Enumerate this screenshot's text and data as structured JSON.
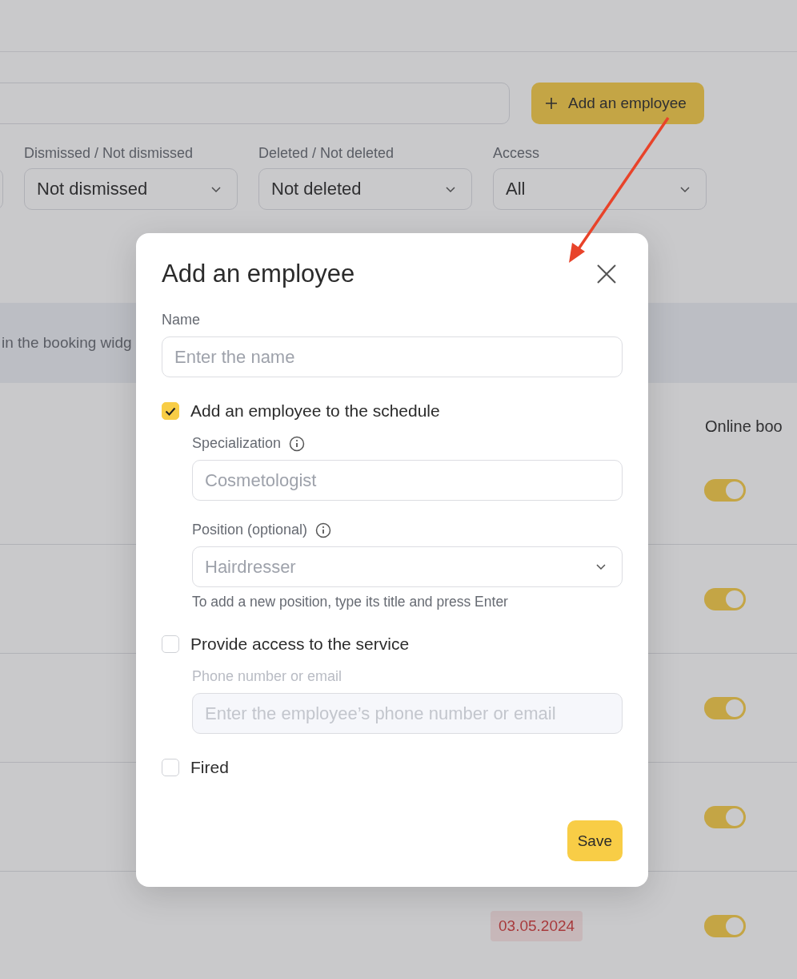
{
  "toolbar": {
    "add_button": "Add an employee"
  },
  "filters": [
    {
      "label": "Dismissed / Not dismissed",
      "value": "Not dismissed"
    },
    {
      "label": "Deleted / Not deleted",
      "value": "Not deleted"
    },
    {
      "label": "Access",
      "value": "All"
    }
  ],
  "banner": {
    "text": "in the booking widg"
  },
  "table": {
    "columns": [
      "Online boo"
    ],
    "rows": [
      {
        "online_booking": true
      },
      {
        "online_booking": true
      },
      {
        "online_booking": true
      },
      {
        "online_booking": true
      },
      {
        "date": "03.05.2024",
        "online_booking": true
      }
    ]
  },
  "modal": {
    "title": "Add an employee",
    "name_field": {
      "label": "Name",
      "placeholder": "Enter the name"
    },
    "schedule": {
      "label": "Add an employee to the schedule",
      "checked": true,
      "specialization": {
        "label": "Specialization",
        "placeholder": "Cosmetologist"
      },
      "position": {
        "label": "Position (optional)",
        "placeholder": "Hairdresser",
        "hint": "To add a new position, type its title and press Enter"
      }
    },
    "access": {
      "label": "Provide access to the service",
      "checked": false,
      "contact": {
        "label": "Phone number or email",
        "placeholder": "Enter the employee’s phone number or email",
        "disabled": true
      }
    },
    "fired": {
      "label": "Fired",
      "checked": false
    },
    "save_button": "Save"
  }
}
